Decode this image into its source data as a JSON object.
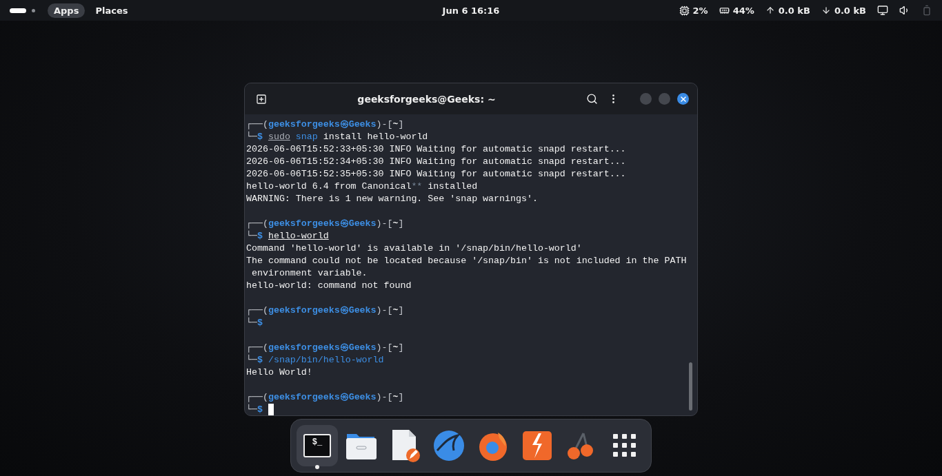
{
  "top_bar": {
    "workspaces": [
      {
        "selected": true
      },
      {
        "selected": false
      }
    ],
    "menus": [
      {
        "label": "Apps",
        "selected": true
      },
      {
        "label": "Places",
        "selected": false
      }
    ],
    "clock": "Jun 6  16:16",
    "indicators": [
      {
        "kind": "cpu",
        "text": "2%"
      },
      {
        "kind": "memory",
        "text": "44%"
      },
      {
        "kind": "upload",
        "text": "0.0 kB"
      },
      {
        "kind": "download",
        "text": "0.0 kB"
      }
    ],
    "tray": [
      {
        "kind": "network",
        "disabled": false
      },
      {
        "kind": "volume",
        "disabled": false
      },
      {
        "kind": "battery",
        "disabled": true
      }
    ]
  },
  "terminal": {
    "title": "geeksforgeeks@Geeks: ~",
    "window_controls": [
      {
        "kind": "minimize"
      },
      {
        "kind": "maximize"
      },
      {
        "kind": "close"
      }
    ],
    "lines": [
      {
        "kind": "text",
        "segments": [
          {
            "text": "┌──(",
            "kind": "frame"
          },
          {
            "text": "geeksforgeeks㉿Geeks",
            "kind": "user"
          },
          {
            "text": ")-[",
            "kind": "frame"
          },
          {
            "text": "~",
            "kind": "dir"
          },
          {
            "text": "]",
            "kind": "frame"
          }
        ]
      },
      {
        "kind": "text",
        "cursor": false,
        "segments": [
          {
            "text": "└─",
            "kind": "frame"
          },
          {
            "text": "$ ",
            "kind": "user"
          },
          {
            "text": "sudo",
            "kind": "dim_underline"
          },
          {
            "text": " snap",
            "kind": "blue"
          },
          {
            "text": " install hello-world",
            "kind": "plain"
          }
        ]
      },
      {
        "kind": "text",
        "segments": [
          {
            "text": "2026-06-06T15:52:33+05:30 INFO Waiting for automatic snapd restart...",
            "kind": "plain"
          }
        ]
      },
      {
        "kind": "text",
        "segments": [
          {
            "text": "2026-06-06T15:52:34+05:30 INFO Waiting for automatic snapd restart...",
            "kind": "plain"
          }
        ]
      },
      {
        "kind": "text",
        "segments": [
          {
            "text": "2026-06-06T15:52:35+05:30 INFO Waiting for automatic snapd restart...",
            "kind": "plain"
          }
        ]
      },
      {
        "kind": "text",
        "segments": [
          {
            "text": "hello-world 6.4 from Canonical",
            "kind": "plain"
          },
          {
            "text": "**",
            "kind": "dim"
          },
          {
            "text": " installed",
            "kind": "plain"
          }
        ]
      },
      {
        "kind": "text",
        "segments": [
          {
            "text": "WARNING: There is 1 new warning. See 'snap warnings'.",
            "kind": "plain"
          }
        ]
      },
      {
        "kind": "blank"
      },
      {
        "kind": "text",
        "segments": [
          {
            "text": "┌──(",
            "kind": "frame"
          },
          {
            "text": "geeksforgeeks㉿Geeks",
            "kind": "user"
          },
          {
            "text": ")-[",
            "kind": "frame"
          },
          {
            "text": "~",
            "kind": "dir"
          },
          {
            "text": "]",
            "kind": "frame"
          }
        ]
      },
      {
        "kind": "text",
        "cursor": false,
        "segments": [
          {
            "text": "└─",
            "kind": "frame"
          },
          {
            "text": "$ ",
            "kind": "user"
          },
          {
            "text": "hello-world",
            "kind": "underline"
          }
        ]
      },
      {
        "kind": "text",
        "segments": [
          {
            "text": "Command 'hello-world' is available in '/snap/bin/hello-world'",
            "kind": "plain"
          }
        ]
      },
      {
        "kind": "text",
        "segments": [
          {
            "text": "The command could not be located because '/snap/bin' is not included in the PATH",
            "kind": "plain"
          }
        ]
      },
      {
        "kind": "text",
        "segments": [
          {
            "text": " environment variable.",
            "kind": "plain"
          }
        ]
      },
      {
        "kind": "text",
        "segments": [
          {
            "text": "hello-world: command not found",
            "kind": "plain"
          }
        ]
      },
      {
        "kind": "blank"
      },
      {
        "kind": "text",
        "segments": [
          {
            "text": "┌──(",
            "kind": "frame"
          },
          {
            "text": "geeksforgeeks㉿Geeks",
            "kind": "user"
          },
          {
            "text": ")-[",
            "kind": "frame"
          },
          {
            "text": "~",
            "kind": "dir"
          },
          {
            "text": "]",
            "kind": "frame"
          }
        ]
      },
      {
        "kind": "text",
        "cursor": false,
        "segments": [
          {
            "text": "└─",
            "kind": "frame"
          },
          {
            "text": "$",
            "kind": "user"
          }
        ]
      },
      {
        "kind": "blank"
      },
      {
        "kind": "text",
        "segments": [
          {
            "text": "┌──(",
            "kind": "frame"
          },
          {
            "text": "geeksforgeeks㉿Geeks",
            "kind": "user"
          },
          {
            "text": ")-[",
            "kind": "frame"
          },
          {
            "text": "~",
            "kind": "dir"
          },
          {
            "text": "]",
            "kind": "frame"
          }
        ]
      },
      {
        "kind": "text",
        "cursor": false,
        "segments": [
          {
            "text": "└─",
            "kind": "frame"
          },
          {
            "text": "$ ",
            "kind": "user"
          },
          {
            "text": "/snap/bin/hello-world",
            "kind": "blue"
          }
        ]
      },
      {
        "kind": "text",
        "segments": [
          {
            "text": "Hello World!",
            "kind": "plain"
          }
        ]
      },
      {
        "kind": "blank"
      },
      {
        "kind": "text",
        "segments": [
          {
            "text": "┌──(",
            "kind": "frame"
          },
          {
            "text": "geeksforgeeks㉿Geeks",
            "kind": "user"
          },
          {
            "text": ")-[",
            "kind": "frame"
          },
          {
            "text": "~",
            "kind": "dir"
          },
          {
            "text": "]",
            "kind": "frame"
          }
        ]
      },
      {
        "kind": "text",
        "cursor": true,
        "segments": [
          {
            "text": "└─",
            "kind": "frame"
          },
          {
            "text": "$ ",
            "kind": "user"
          }
        ]
      }
    ]
  },
  "dock": [
    {
      "kind": "terminal",
      "glyph": "$_",
      "selected": true
    },
    {
      "kind": "files",
      "selected": false
    },
    {
      "kind": "editor",
      "selected": false
    },
    {
      "kind": "wireshark",
      "selected": false
    },
    {
      "kind": "firefox",
      "selected": false
    },
    {
      "kind": "burp",
      "selected": false
    },
    {
      "kind": "cherry",
      "selected": false
    },
    {
      "kind": "apps",
      "selected": false
    }
  ]
}
